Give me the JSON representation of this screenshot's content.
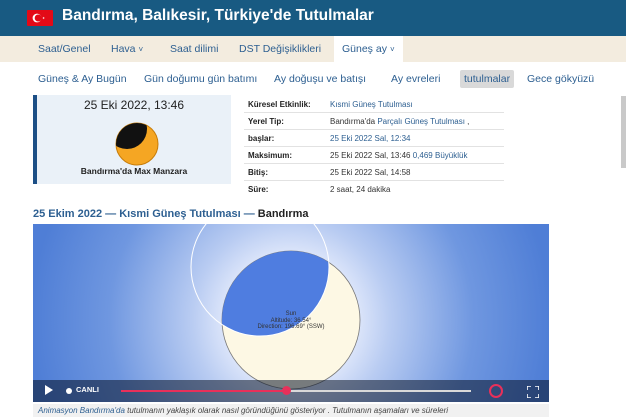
{
  "header": {
    "title": "Bandırma, Balıkesir, Türkiye'de Tutulmalar",
    "flag_icon": "turkey-flag-icon",
    "brand_color": "#185a82"
  },
  "main_nav": {
    "items": [
      {
        "label": "Saat/Genel"
      },
      {
        "label": "Hava",
        "chevron": "˅"
      },
      {
        "label": "Saat dilimi"
      },
      {
        "label": "DST Değişiklikleri"
      },
      {
        "label": "Güneş ay",
        "chevron": "˅",
        "active": true
      }
    ]
  },
  "sub_nav": {
    "items": [
      {
        "label": "Güneş & Ay Bugün"
      },
      {
        "label": "Gün doğumu gün batımı"
      },
      {
        "label": "Ay doğuşu ve batışı"
      },
      {
        "label": "Ay evreleri"
      },
      {
        "label": "tutulmalar",
        "active": true
      },
      {
        "label": "Gece gökyüzü"
      }
    ]
  },
  "summary": {
    "datetime": "25 Eki 2022, 13:46",
    "caption": "Bandırma'da Max Manzara",
    "icon": "partial-solar-eclipse-icon"
  },
  "details": [
    {
      "key": "Küresel Etkinlik:",
      "value": "Kısmi Güneş Tutulması"
    },
    {
      "key": "Yerel Tip:",
      "value_prefix": "Bandırma'da ",
      "value": "Parçalı Güneş Tutulması",
      "value_suffix": " ,"
    },
    {
      "key": "başlar:",
      "value": "25 Eki 2022 Sal, 12:34"
    },
    {
      "key": "Maksimum:",
      "value_prefix": "25 Eki 2022 Sal, 13:46 ",
      "value": "0,469 Büyüklük"
    },
    {
      "key": "Bitiş:",
      "value": "25 Eki 2022 Sal, 14:58"
    },
    {
      "key": "Süre:",
      "value": "2 saat, 24 dakika"
    }
  ],
  "section": {
    "title_link": "25 Ekim 2022 — Kısmi Güneş Tutulması —",
    "title_place": " Bandırma"
  },
  "animation": {
    "sun_label": "Sun",
    "altitude": "Altitude: 36.54°",
    "direction": "Direction: 196.69° (SSW)",
    "live_label": "CANLI",
    "progress": 0.47
  },
  "caption": {
    "link1": "Animasyon Bandırma'da",
    "text": " tutulmanın yaklaşık olarak nasıl göründüğünü gösteriyor . Tutulmanın aşamaları ve süreleri"
  }
}
